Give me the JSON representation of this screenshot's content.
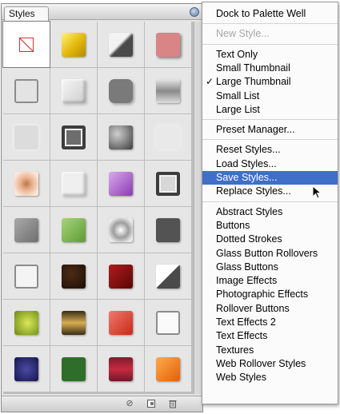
{
  "palette": {
    "tab_label": "Styles",
    "selected_index": 0,
    "swatches": [
      {
        "name": "default-none-style",
        "bg": "#ffffff",
        "kind": "none"
      },
      {
        "name": "gold-bevel-style",
        "bg": "linear-gradient(135deg,#fff27a,#e3b70c 55%,#b58a05)",
        "kind": "plain"
      },
      {
        "name": "chrome-diagonal-style",
        "bg": "linear-gradient(135deg,#f2f2f2 45%,#4a4a4a 55%)",
        "kind": "plain"
      },
      {
        "name": "pink-shadow-style",
        "bg": "#d98585",
        "kind": "shadow"
      },
      {
        "name": "outline-gray-style",
        "bg": "#e3e3e3",
        "kind": "outline"
      },
      {
        "name": "soft-bevel-style",
        "bg": "linear-gradient(135deg,#f5f5f5,#cfcfcf)",
        "kind": "soft"
      },
      {
        "name": "dark-rounded-style",
        "bg": "#7a7a7a",
        "kind": "rounded"
      },
      {
        "name": "metal-stripe-style",
        "bg": "linear-gradient(#e5e5e5,#8a8a8a 50%,#dcdcdc)",
        "kind": "plain"
      },
      {
        "name": "faint-gray-style",
        "bg": "#dcdcdc",
        "kind": "faint"
      },
      {
        "name": "dark-frame-style",
        "bg": "#6d6d6d",
        "kind": "frame"
      },
      {
        "name": "textured-stone-style",
        "bg": "radial-gradient(circle at 35% 35%,#d0d0d0,#3b3b3b)",
        "kind": "plain"
      },
      {
        "name": "blank-glow-style",
        "bg": "#e9e9e9",
        "kind": "faint"
      },
      {
        "name": "peach-dot-style",
        "bg": "radial-gradient(circle,#b9774a 0,#e9b08e 35%,#fce7da 80%)",
        "kind": "plain"
      },
      {
        "name": "inset-white-style",
        "bg": "#efefef",
        "kind": "soft"
      },
      {
        "name": "purple-bevel-style",
        "bg": "linear-gradient(135deg,#d9a9ee,#8a3bb1)",
        "kind": "plain"
      },
      {
        "name": "gray-frame-style",
        "bg": "#d7d7d7",
        "kind": "frame"
      },
      {
        "name": "gray-noise-style",
        "bg": "linear-gradient(135deg,#a9a9a9,#6f6f6f)",
        "kind": "plain"
      },
      {
        "name": "green-bevel-style",
        "bg": "linear-gradient(135deg,#a7d57a,#5d9a33)",
        "kind": "plain"
      },
      {
        "name": "glow-dot-style",
        "bg": "radial-gradient(circle,#ffffff 0,#9d9d9d 45%,#eaeaea 80%)",
        "kind": "plain"
      },
      {
        "name": "charcoal-style",
        "bg": "#535353",
        "kind": "plain"
      },
      {
        "name": "white-plain-style",
        "bg": "#f4f4f4",
        "kind": "outline"
      },
      {
        "name": "dark-brown-style",
        "bg": "radial-gradient(circle at 40% 40%,#4d2b17,#1d0e05)",
        "kind": "plain"
      },
      {
        "name": "crimson-style",
        "bg": "linear-gradient(135deg,#b01d1d,#5a0606)",
        "kind": "plain"
      },
      {
        "name": "white-dark-diagonal-style",
        "bg": "linear-gradient(135deg,#ffffff 50%,#4a4a4a 50%)",
        "kind": "plain"
      },
      {
        "name": "yellow-green-style",
        "bg": "radial-gradient(circle at 55% 50%,#dbe85a,#6a8a10)",
        "kind": "plain"
      },
      {
        "name": "bronze-style",
        "bg": "linear-gradient(#3a2d16,#d7ac52 50%,#3a2d16)",
        "kind": "plain"
      },
      {
        "name": "red-marble-style",
        "bg": "linear-gradient(135deg,#ef7a6d,#c92918)",
        "kind": "plain"
      },
      {
        "name": "white-frame-style",
        "bg": "#fafafa",
        "kind": "outline"
      },
      {
        "name": "navy-texture-style",
        "bg": "radial-gradient(circle,#4b4aa1,#16164f)",
        "kind": "plain"
      },
      {
        "name": "forest-green-style",
        "bg": "#2f6e2a",
        "kind": "plain"
      },
      {
        "name": "red-stripe-style",
        "bg": "linear-gradient(#7c1d2e,#c7283f 50%,#6e1a2a)",
        "kind": "plain"
      },
      {
        "name": "orange-style",
        "bg": "linear-gradient(135deg,#ffaa4a,#e0600b)",
        "kind": "plain"
      }
    ]
  },
  "menu": {
    "items": [
      {
        "type": "item",
        "label": "Dock to Palette Well",
        "name": "menu-dock-to-palette-well"
      },
      {
        "type": "sep"
      },
      {
        "type": "item",
        "label": "New Style...",
        "name": "menu-new-style",
        "disabled": true
      },
      {
        "type": "sep"
      },
      {
        "type": "item",
        "label": "Text Only",
        "name": "menu-text-only"
      },
      {
        "type": "item",
        "label": "Small Thumbnail",
        "name": "menu-small-thumbnail"
      },
      {
        "type": "item",
        "label": "Large Thumbnail",
        "name": "menu-large-thumbnail",
        "checked": true
      },
      {
        "type": "item",
        "label": "Small List",
        "name": "menu-small-list"
      },
      {
        "type": "item",
        "label": "Large List",
        "name": "menu-large-list"
      },
      {
        "type": "sep"
      },
      {
        "type": "item",
        "label": "Preset Manager...",
        "name": "menu-preset-manager"
      },
      {
        "type": "sep"
      },
      {
        "type": "item",
        "label": "Reset Styles...",
        "name": "menu-reset-styles"
      },
      {
        "type": "item",
        "label": "Load Styles...",
        "name": "menu-load-styles"
      },
      {
        "type": "item",
        "label": "Save Styles...",
        "name": "menu-save-styles",
        "highlighted": true
      },
      {
        "type": "item",
        "label": "Replace Styles...",
        "name": "menu-replace-styles"
      },
      {
        "type": "sep"
      },
      {
        "type": "item",
        "label": "Abstract Styles",
        "name": "menu-abstract-styles"
      },
      {
        "type": "item",
        "label": "Buttons",
        "name": "menu-buttons"
      },
      {
        "type": "item",
        "label": "Dotted Strokes",
        "name": "menu-dotted-strokes"
      },
      {
        "type": "item",
        "label": "Glass Button Rollovers",
        "name": "menu-glass-button-rollovers"
      },
      {
        "type": "item",
        "label": "Glass Buttons",
        "name": "menu-glass-buttons"
      },
      {
        "type": "item",
        "label": "Image Effects",
        "name": "menu-image-effects"
      },
      {
        "type": "item",
        "label": "Photographic Effects",
        "name": "menu-photographic-effects"
      },
      {
        "type": "item",
        "label": "Rollover Buttons",
        "name": "menu-rollover-buttons"
      },
      {
        "type": "item",
        "label": "Text Effects 2",
        "name": "menu-text-effects-2"
      },
      {
        "type": "item",
        "label": "Text Effects",
        "name": "menu-text-effects"
      },
      {
        "type": "item",
        "label": "Textures",
        "name": "menu-textures"
      },
      {
        "type": "item",
        "label": "Web Rollover Styles",
        "name": "menu-web-rollover-styles"
      },
      {
        "type": "item",
        "label": "Web Styles",
        "name": "menu-web-styles"
      }
    ],
    "check_glyph": "✓"
  },
  "bottombar": {
    "icons": [
      "clear-style-icon",
      "new-style-icon",
      "trash-icon"
    ]
  }
}
